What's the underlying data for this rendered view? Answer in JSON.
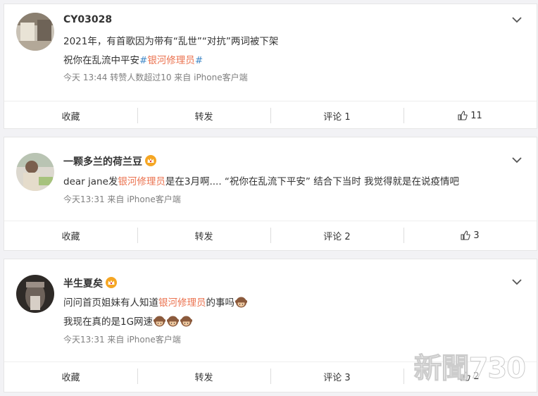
{
  "posts": [
    {
      "username": "CY03028",
      "has_crown": false,
      "lines": [
        {
          "parts": [
            {
              "t": "2021年，有首歌因为带有“乱世”“对抗”两词被下架",
              "c": ""
            }
          ]
        },
        {
          "parts": [
            {
              "t": "祝你在乱流中平安",
              "c": ""
            },
            {
              "t": "#",
              "c": "tag-hash"
            },
            {
              "t": "银河修理员",
              "c": "tag"
            },
            {
              "t": "#",
              "c": "tag-hash"
            }
          ]
        }
      ],
      "meta": "今天 13:44 转赞人数超过10   来自 iPhone客户端",
      "actions": {
        "collect": "收藏",
        "repost": "转发",
        "comment": "评论 1",
        "like": "11"
      }
    },
    {
      "username": "一颗多兰的荷兰豆",
      "has_crown": true,
      "lines": [
        {
          "parts": [
            {
              "t": "dear jane发",
              "c": ""
            },
            {
              "t": "银河修理员",
              "c": "hl"
            },
            {
              "t": "是在3月啊....  “祝你在乱流下平安” 结合下当时 我觉得就是在说疫情吧",
              "c": ""
            }
          ]
        }
      ],
      "meta": "今天13:31  来自 iPhone客户端",
      "actions": {
        "collect": "收藏",
        "repost": "转发",
        "comment": "评论 2",
        "like": "3"
      }
    },
    {
      "username": "半生夏矣",
      "has_crown": true,
      "lines": [
        {
          "parts": [
            {
              "t": "问问首页姐妹有人知道",
              "c": ""
            },
            {
              "t": "银河修理员",
              "c": "hl"
            },
            {
              "t": "的事吗",
              "c": ""
            },
            {
              "e": "monkey"
            }
          ]
        },
        {
          "parts": [
            {
              "t": "我现在真的是1G网速",
              "c": ""
            },
            {
              "e": "monkey"
            },
            {
              "e": "monkey"
            },
            {
              "e": "monkey"
            }
          ]
        }
      ],
      "meta": "今天13:31  来自 iPhone客户端",
      "actions": {
        "collect": "收藏",
        "repost": "转发",
        "comment": "评论 3",
        "like": "2"
      }
    }
  ],
  "watermark": "新聞730",
  "colors": {
    "highlight": "#eb7350",
    "hashtag": "#3f87c7",
    "meta": "#808080",
    "crown": "#f5a623"
  }
}
